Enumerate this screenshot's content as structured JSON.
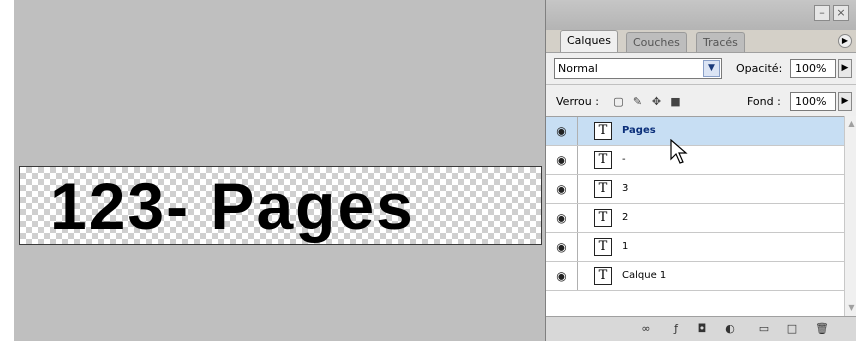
{
  "canvas": {
    "document_text": "123- Pages"
  },
  "layers_panel": {
    "tabs": [
      {
        "label": "Calques",
        "active": true
      },
      {
        "label": "Couches",
        "active": false
      },
      {
        "label": "Tracés",
        "active": false
      }
    ],
    "blend_mode": "Normal",
    "opacity_label": "Opacité:",
    "opacity_value": "100%",
    "lock_label": "Verrou :",
    "fill_label": "Fond :",
    "fill_value": "100%",
    "layers": [
      {
        "name": "Pages",
        "type": "text",
        "visible": true,
        "selected": true
      },
      {
        "name": "-",
        "type": "text",
        "visible": true,
        "selected": false
      },
      {
        "name": "3",
        "type": "text",
        "visible": true,
        "selected": false
      },
      {
        "name": "2",
        "type": "text",
        "visible": true,
        "selected": false
      },
      {
        "name": "1",
        "type": "text",
        "visible": true,
        "selected": false
      },
      {
        "name": "Calque 1",
        "type": "text",
        "visible": true,
        "selected": false
      }
    ],
    "thumb_glyph": "T",
    "bottom_icons": [
      "link-icon",
      "layer-style-icon",
      "mask-icon",
      "adjustment-icon",
      "folder-icon",
      "new-layer-icon",
      "trash-icon"
    ]
  },
  "colors": {
    "canvas_bg": "#bfbfbf",
    "selected_layer": "#c7def3"
  }
}
